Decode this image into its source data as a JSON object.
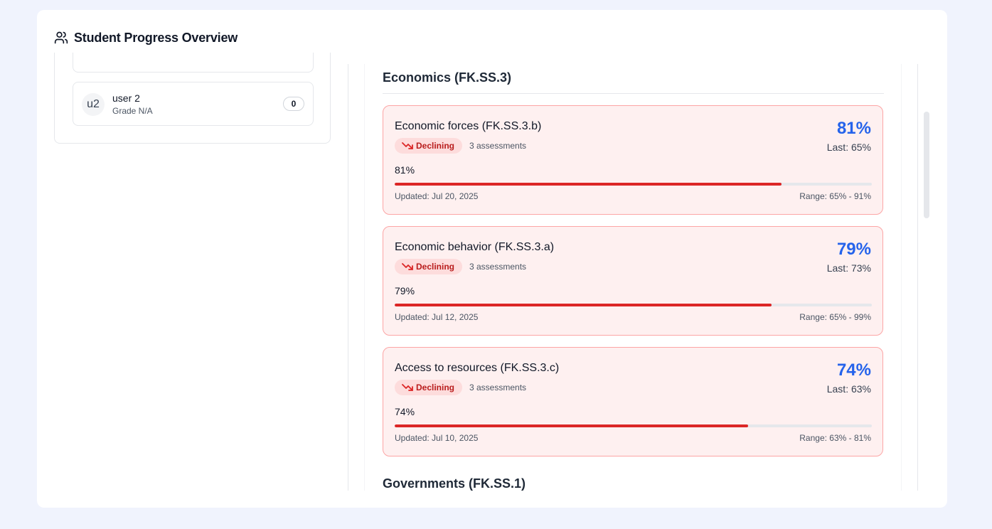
{
  "header": {
    "title": "Student Progress Overview",
    "icon": "users-icon"
  },
  "students": [
    {
      "avatar": "u2",
      "name": "user 2",
      "grade": "Grade N/A",
      "count": "0"
    }
  ],
  "sections": [
    {
      "title": "Economics (FK.SS.3)",
      "standards": [
        {
          "name": "Economic forces (FK.SS.3.b)",
          "trend": "Declining",
          "assessments": "3 assessments",
          "score": "81%",
          "last": "Last: 65%",
          "progress_label": "81%",
          "progress": 81,
          "updated": "Updated: Jul 20, 2025",
          "range": "Range: 65% - 91%"
        },
        {
          "name": "Economic behavior (FK.SS.3.a)",
          "trend": "Declining",
          "assessments": "3 assessments",
          "score": "79%",
          "last": "Last: 73%",
          "progress_label": "79%",
          "progress": 79,
          "updated": "Updated: Jul 12, 2025",
          "range": "Range: 65% - 99%"
        },
        {
          "name": "Access to resources (FK.SS.3.c)",
          "trend": "Declining",
          "assessments": "3 assessments",
          "score": "74%",
          "last": "Last: 63%",
          "progress_label": "74%",
          "progress": 74,
          "updated": "Updated: Jul 10, 2025",
          "range": "Range: 63% - 81%"
        }
      ]
    },
    {
      "title": "Governments (FK.SS.1)"
    }
  ],
  "colors": {
    "score_blue": "#2563eb",
    "declining_red": "#dc2626",
    "card_bg": "#fef0f0",
    "card_border": "#fca5a5"
  }
}
